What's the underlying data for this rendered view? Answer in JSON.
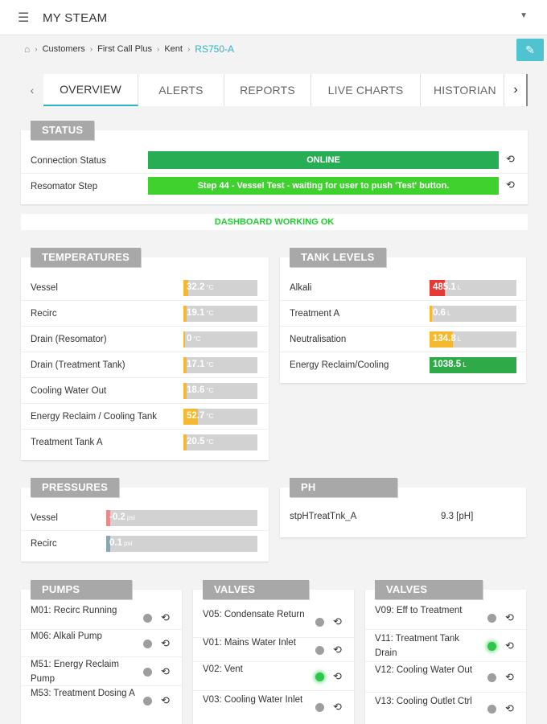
{
  "app": {
    "title": "MY STEAM",
    "menu_icon": "hamburger-icon",
    "dropdown_icon": "caret-down-icon"
  },
  "breadcrumb": [
    "Customers",
    "First Call Plus",
    "Kent",
    "RS750-A"
  ],
  "edit_icon": "pencil-icon",
  "tabs": [
    "OVERVIEW",
    "ALERTS",
    "REPORTS",
    "LIVE CHARTS",
    "HISTORIAN"
  ],
  "status": {
    "title": "STATUS",
    "connection_label": "Connection Status",
    "connection_value": "ONLINE",
    "step_label": "Resomator Step",
    "step_value": "Step 44 - Vessel Test - waiting for user to push 'Test' button.",
    "colors": {
      "online": "#27ae54",
      "step": "#3fd12e"
    }
  },
  "dashboard_ok": "DASHBOARD WORKING OK",
  "temperatures": {
    "title": "TEMPERATURES",
    "unit": "°C",
    "rows": [
      {
        "label": "Vessel",
        "value": "32.2",
        "fill": 0.06,
        "color": "#f5b82e"
      },
      {
        "label": "Recirc",
        "value": "19.1",
        "fill": 0.04,
        "color": "#f5b82e"
      },
      {
        "label": "Drain (Resomator)",
        "value": "0",
        "fill": 0.0,
        "color": "#f5b82e"
      },
      {
        "label": "Drain (Treatment Tank)",
        "value": "17.1",
        "fill": 0.04,
        "color": "#f5b82e"
      },
      {
        "label": "Cooling Water Out",
        "value": "18.6",
        "fill": 0.04,
        "color": "#f5b82e"
      },
      {
        "label": "Energy Reclaim / Cooling Tank",
        "value": "52.7",
        "fill": 0.2,
        "color": "#f5b82e"
      },
      {
        "label": "Treatment Tank A",
        "value": "20.5",
        "fill": 0.04,
        "color": "#f5b82e"
      }
    ]
  },
  "tank_levels": {
    "title": "TANK LEVELS",
    "unit": "L",
    "rows": [
      {
        "label": "Alkali",
        "value": "485.1",
        "fill": 0.18,
        "color": "#e53935"
      },
      {
        "label": "Treatment A",
        "value": "0.6",
        "fill": 0.0,
        "color": "#f5b82e"
      },
      {
        "label": "Neutralisation",
        "value": "134.8",
        "fill": 0.27,
        "color": "#f5b82e"
      },
      {
        "label": "Energy Reclaim/Cooling",
        "value": "1038.5",
        "fill": 1.0,
        "color": "#2eaa49"
      }
    ]
  },
  "pressures": {
    "title": "PRESSURES",
    "unit": "psi",
    "rows": [
      {
        "label": "Vessel",
        "value": "-0.2",
        "fill": 0.01,
        "color": "#e88a8a"
      },
      {
        "label": "Recirc",
        "value": "0.1",
        "fill": 0.01,
        "color": "#8aa6b0"
      }
    ]
  },
  "ph": {
    "title": "PH",
    "label": "stpHTreatTnk_A",
    "value": "9.3 [pH]"
  },
  "pumps": {
    "title": "PUMPS",
    "rows": [
      {
        "label": "M01: Recirc Running",
        "on": false
      },
      {
        "label": "M06: Alkali Pump",
        "on": false
      },
      {
        "label": "M51: Energy Reclaim Pump",
        "on": false
      },
      {
        "label": "M53: Treatment Dosing A",
        "on": false
      }
    ]
  },
  "valves_a": {
    "title": "VALVES",
    "rows": [
      {
        "label": "V05: Condensate Return",
        "on": false
      },
      {
        "label": "V01: Mains Water Inlet",
        "on": false
      },
      {
        "label": "V02: Vent",
        "on": true
      },
      {
        "label": "V03: Cooling Water Inlet",
        "on": false
      }
    ]
  },
  "valves_b": {
    "title": "VALVES",
    "rows": [
      {
        "label": "V09: Eff to Treatment",
        "on": false
      },
      {
        "label": "V11: Treatment Tank Drain",
        "on": true
      },
      {
        "label": "V12: Cooling Water Out",
        "on": false
      },
      {
        "label": "V13: Cooling Outlet Ctrl",
        "on": false
      }
    ]
  },
  "history_icon": "history-icon"
}
